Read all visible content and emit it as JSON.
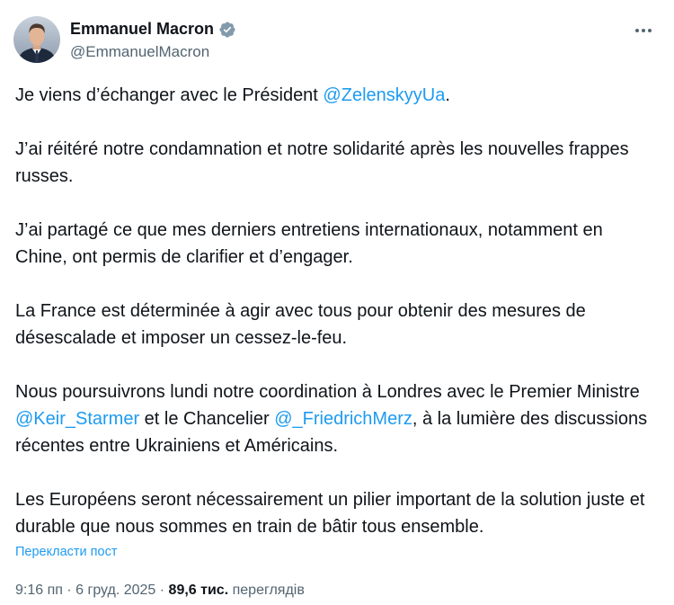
{
  "author": {
    "display_name": "Emmanuel Macron",
    "handle": "@EmmanuelMacron",
    "verified_color": "#829aab"
  },
  "icons": {
    "avatar": "profile-photo",
    "verified": "verified-badge-icon",
    "more": "more-horizontal-icon"
  },
  "tweet": {
    "p1_text_a": "Je viens d’échanger avec le Président ",
    "p1_mention": "@ZelenskyyUa",
    "p1_text_b": ".",
    "p2": "J’ai réitéré notre condamnation et notre solidarité après les nouvelles frappes russes.",
    "p3": "J’ai partagé ce que mes derniers entretiens internationaux, notamment en Chine, ont permis de clarifier et d’engager.",
    "p4": "La France est déterminée à agir avec tous pour obtenir des mesures de désescalade et imposer un cessez-le-feu.",
    "p5_text_a": "Nous poursuivrons lundi notre coordination à Londres avec le Premier Ministre ",
    "p5_mention_1": "@Keir_Starmer",
    "p5_text_b": " et le Chancelier ",
    "p5_mention_2": "@_FriedrichMerz",
    "p5_text_c": ", à la lumière des discussions récentes entre Ukrainiens et Américains.",
    "p6": "Les Européens seront nécessairement un pilier important de la solution juste et durable que nous sommes en train de bâtir tous ensemble."
  },
  "translate_label": "Перекласти пост",
  "meta": {
    "time": "9:16 пп",
    "separator": " · ",
    "date": "6 груд. 2025",
    "views_count": "89,6 тис.",
    "views_label": "переглядів"
  },
  "colors": {
    "link": "#1d9bf0",
    "text": "#0f1419",
    "secondary": "#536471"
  }
}
